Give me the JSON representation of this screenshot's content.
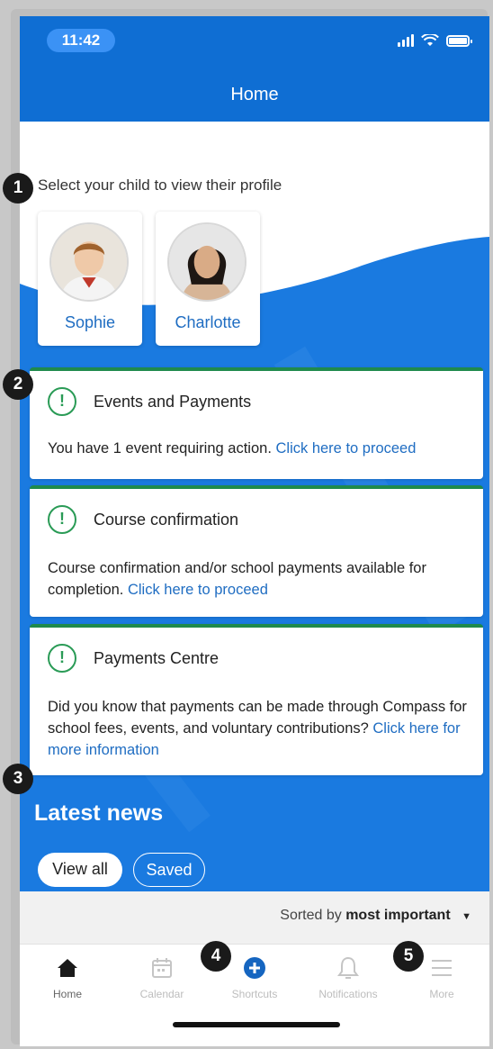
{
  "status_bar": {
    "time": "11:42"
  },
  "nav": {
    "title": "Home"
  },
  "children": {
    "prompt": "Select your child to view their profile",
    "items": [
      {
        "name": "Sophie"
      },
      {
        "name": "Charlotte"
      }
    ]
  },
  "cards": [
    {
      "title": "Events and Payments",
      "body": "You have 1 event requiring action. ",
      "link": "Click here to proceed"
    },
    {
      "title": "Course confirmation",
      "body": "Course confirmation and/or school payments available for completion. ",
      "link": "Click here to proceed"
    },
    {
      "title": "Payments Centre",
      "body": "Did you know that payments can be made through Compass for school fees, events, and voluntary contributions? ",
      "link": "Click here for more information"
    }
  ],
  "news": {
    "title": "Latest news",
    "view_all": "View all",
    "saved": "Saved",
    "sort_prefix": "Sorted by",
    "sort_value": "most important"
  },
  "tabs": [
    {
      "label": "Home",
      "icon": "home-icon"
    },
    {
      "label": "Calendar",
      "icon": "calendar-icon"
    },
    {
      "label": "Shortcuts",
      "icon": "plus-circle-icon"
    },
    {
      "label": "Notifications",
      "icon": "bell-icon"
    },
    {
      "label": "More",
      "icon": "menu-icon"
    }
  ],
  "badges": [
    "1",
    "2",
    "3",
    "4",
    "5"
  ],
  "colors": {
    "brand_blue": "#0f6ed3",
    "link_blue": "#1f6dc2",
    "accent_green": "#1f8a4c"
  }
}
